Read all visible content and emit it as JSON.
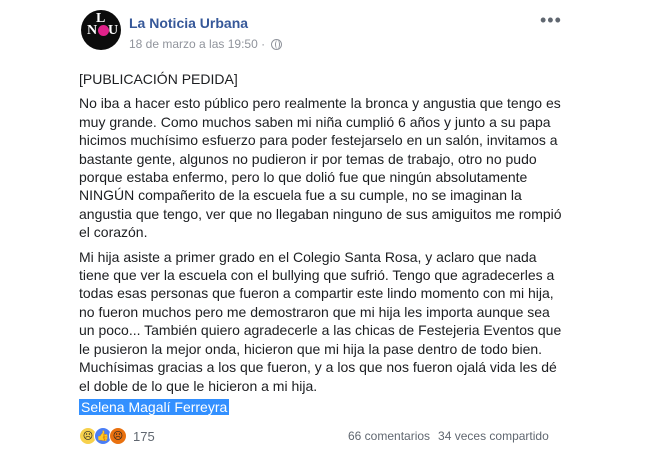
{
  "page": {
    "name": "La Noticia Urbana",
    "avatar_letters": {
      "l": "L",
      "n": "N",
      "o": "O",
      "u": "U"
    }
  },
  "post": {
    "timestamp": "18 de marzo a las 19:50 ·",
    "more_label": "•••",
    "header_line": "[PUBLICACIÓN PEDIDA]",
    "paragraph_1": "No iba a hacer esto público pero realmente la bronca y angustia que tengo es muy grande. Como muchos saben mi niña cumplió 6 años y junto a su papa hicimos muchísimo esfuerzo para poder festejarselo en un salón, invitamos a bastante gente, algunos no pudieron ir por temas de trabajo, otro no pudo porque estaba enfermo, pero lo que dolió fue que ningún absolutamente NINGÚN compañerito de la escuela fue a su cumple, no se imaginan la angustia que tengo, ver que no llegaban ninguno de sus amiguitos me rompió el corazón.",
    "paragraph_2": "Mi hija asiste a primer grado en el Colegio Santa Rosa, y aclaro que nada tiene que ver la escuela con el bullying que sufrió. Tengo que agradecerles a todas esas personas que fueron a compartir este lindo momento con mi hija, no fueron muchos pero me demostraron que mi hija les importa aunque sea un poco... También quiero agradecerle a las chicas de Festejeria Eventos que le pusieron la mejor onda, hicieron que mi hija la pase dentro de todo bien. Muchísimas gracias a los que fueron, y a los que nos fueron ojalá vida les dé el doble de lo que le hicieron a mi hija.",
    "signature": "Selena Magalí Ferreyra"
  },
  "footer": {
    "reaction_count": "175",
    "comments": "66 comentarios",
    "shares": "34 veces compartido",
    "reaction_icons": [
      "sad-icon",
      "like-icon",
      "angry-icon"
    ]
  }
}
